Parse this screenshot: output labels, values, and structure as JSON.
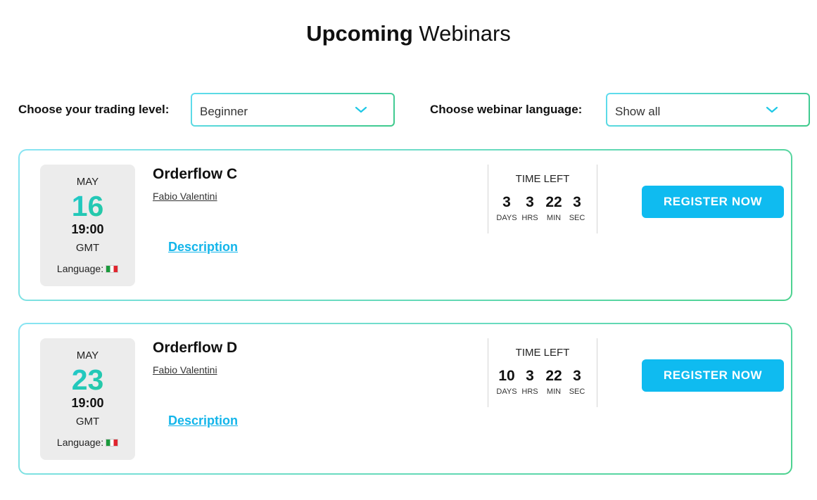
{
  "header": {
    "title_bold": "Upcoming",
    "title_rest": "Webinars"
  },
  "filters": {
    "level_label": "Choose your trading level:",
    "level_value": "Beginner",
    "language_label": "Choose webinar language:",
    "language_value": "Show all"
  },
  "webinars": [
    {
      "month": "MAY",
      "day": "16",
      "time": "19:00",
      "timezone": "GMT",
      "language_label": "Language:",
      "language_flag": "italy-flag-icon",
      "title": "Orderflow C",
      "presenter": "Fabio Valentini",
      "description_label": "Description",
      "time_left_label": "TIME LEFT",
      "countdown": {
        "days": "3",
        "hrs": "3",
        "min": "22",
        "sec": "3"
      },
      "units": {
        "days": "DAYS",
        "hrs": "HRS",
        "min": "MIN",
        "sec": "SEC"
      },
      "register_label": "REGISTER NOW"
    },
    {
      "month": "MAY",
      "day": "23",
      "time": "19:00",
      "timezone": "GMT",
      "language_label": "Language:",
      "language_flag": "italy-flag-icon",
      "title": "Orderflow D",
      "presenter": "Fabio Valentini",
      "description_label": "Description",
      "time_left_label": "TIME LEFT",
      "countdown": {
        "days": "10",
        "hrs": "3",
        "min": "22",
        "sec": "3"
      },
      "units": {
        "days": "DAYS",
        "hrs": "HRS",
        "min": "MIN",
        "sec": "SEC"
      },
      "register_label": "REGISTER NOW"
    }
  ],
  "colors": {
    "accent_blue": "#0fbbf0",
    "accent_green": "#29c987",
    "link": "#13b5ea"
  }
}
